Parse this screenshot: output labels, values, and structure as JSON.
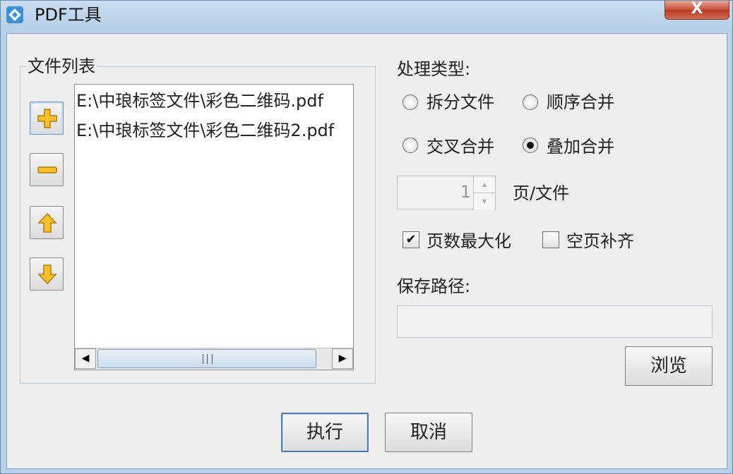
{
  "window": {
    "title": "PDF工具",
    "close_label": "X"
  },
  "file_group": {
    "label": "文件列表",
    "files": [
      "E:\\中琅标签文件\\彩色二维码.pdf",
      "E:\\中琅标签文件\\彩色二维码2.pdf"
    ]
  },
  "process": {
    "label": "处理类型:",
    "options": [
      "拆分文件",
      "顺序合并",
      "交叉合并",
      "叠加合并"
    ],
    "selected": "叠加合并"
  },
  "pages": {
    "value": "1",
    "unit_label": "页/文件"
  },
  "checks": {
    "maximize_label": "页数最大化",
    "maximize_checked": true,
    "blank_fill_label": "空页补齐",
    "blank_fill_checked": false
  },
  "save": {
    "label": "保存路径:",
    "path": "",
    "browse_label": "浏览"
  },
  "actions": {
    "execute_label": "执行",
    "cancel_label": "取消"
  }
}
